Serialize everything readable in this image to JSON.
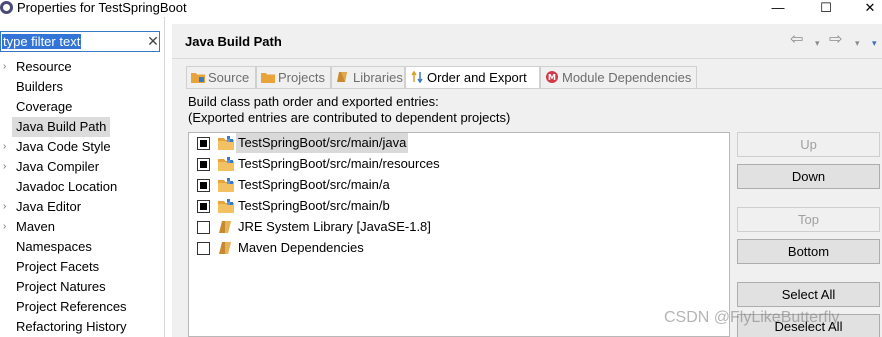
{
  "window": {
    "title": "Properties for TestSpringBoot",
    "minimize_glyph": "—",
    "maximize_glyph": "☐",
    "close_glyph": "✕"
  },
  "filter": {
    "value": "type filter text",
    "clear_glyph": "✕"
  },
  "tree": [
    {
      "label": "Resource",
      "expandable": true
    },
    {
      "label": "Builders",
      "expandable": false
    },
    {
      "label": "Coverage",
      "expandable": false
    },
    {
      "label": "Java Build Path",
      "expandable": false,
      "selected": true
    },
    {
      "label": "Java Code Style",
      "expandable": true
    },
    {
      "label": "Java Compiler",
      "expandable": true
    },
    {
      "label": "Javadoc Location",
      "expandable": false
    },
    {
      "label": "Java Editor",
      "expandable": true
    },
    {
      "label": "Maven",
      "expandable": true
    },
    {
      "label": "Namespaces",
      "expandable": false
    },
    {
      "label": "Project Facets",
      "expandable": false
    },
    {
      "label": "Project Natures",
      "expandable": false
    },
    {
      "label": "Project References",
      "expandable": false
    },
    {
      "label": "Refactoring History",
      "expandable": false
    }
  ],
  "page": {
    "title": "Java Build Path",
    "nav_back": "⇦",
    "nav_forward": "⇨",
    "nav_dropdown": "▾"
  },
  "tabs": [
    {
      "label": "Source",
      "icon": "source-folder-icon"
    },
    {
      "label": "Projects",
      "icon": "projects-folder-icon"
    },
    {
      "label": "Libraries",
      "icon": "library-icon"
    },
    {
      "label": "Order and Export",
      "icon": "order-export-icon",
      "active": true
    },
    {
      "label": "Module Dependencies",
      "icon": "module-icon"
    }
  ],
  "description": {
    "line1": "Build class path order and exported entries:",
    "line2": "(Exported entries are contributed to dependent projects)"
  },
  "entries": [
    {
      "label": "TestSpringBoot/src/main/java",
      "checked": true,
      "icon": "source-folder-icon",
      "selected": true
    },
    {
      "label": "TestSpringBoot/src/main/resources",
      "checked": true,
      "icon": "source-folder-icon"
    },
    {
      "label": "TestSpringBoot/src/main/a",
      "checked": true,
      "icon": "source-folder-icon"
    },
    {
      "label": "TestSpringBoot/src/main/b",
      "checked": true,
      "icon": "source-folder-icon"
    },
    {
      "label": "JRE System Library [JavaSE-1.8]",
      "checked": false,
      "icon": "library-icon"
    },
    {
      "label": "Maven Dependencies",
      "checked": false,
      "icon": "library-icon"
    }
  ],
  "buttons": {
    "up": "Up",
    "down": "Down",
    "top": "Top",
    "bottom": "Bottom",
    "select_all": "Select All",
    "deselect_all": "Deselect All"
  },
  "watermark": "CSDN @FlyLikeButterfly",
  "colors": {
    "selection": "#3375d6",
    "tab_active_bg": "#ffffff",
    "folder": "#e8a33a"
  }
}
